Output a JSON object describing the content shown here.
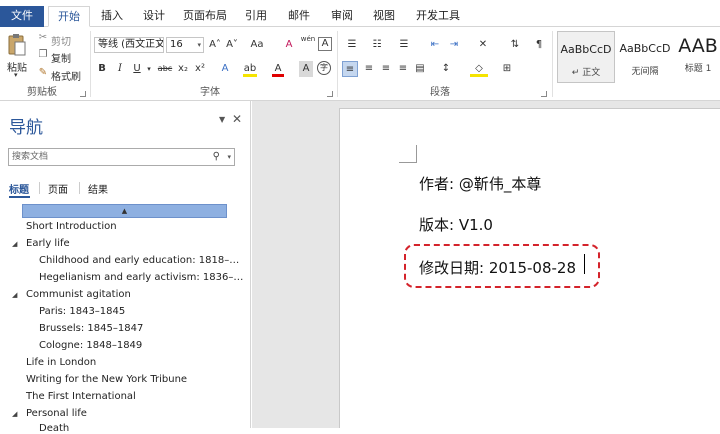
{
  "ribbon_tabs": [
    {
      "label": "文件"
    },
    {
      "label": "开始"
    },
    {
      "label": "插入"
    },
    {
      "label": "设计"
    },
    {
      "label": "页面布局"
    },
    {
      "label": "引用"
    },
    {
      "label": "邮件"
    },
    {
      "label": "审阅"
    },
    {
      "label": "视图"
    },
    {
      "label": "开发工具"
    }
  ],
  "clipboard": {
    "paste": "粘贴",
    "cut": "剪切",
    "copy": "复制",
    "format_painter": "格式刷",
    "group_label": "剪贴板"
  },
  "font": {
    "name": "等线 (西文正文",
    "size": "16",
    "group_label": "字体",
    "buttons": {
      "bold": "B",
      "italic": "I",
      "underline": "U",
      "strike": "abc",
      "subscript": "x₂",
      "superscript": "x²",
      "grow": "A˄",
      "shrink": "A˅",
      "case": "Aa",
      "clear": "A",
      "phonetic": "wén",
      "border_char": "A",
      "effects": "A",
      "highlight": "ab",
      "color": "A",
      "shade": "A",
      "enclose": "字"
    }
  },
  "paragraph": {
    "group_label": "段落"
  },
  "styles": [
    {
      "sample": "AaBbCcD",
      "name": "↵ 正文"
    },
    {
      "sample": "AaBbCcD",
      "name": "无间隔"
    },
    {
      "sample": "AAB",
      "name": "标题 1"
    }
  ],
  "nav": {
    "title": "导航",
    "search_placeholder": "搜索文档",
    "tabs": [
      "标题",
      "页面",
      "结果"
    ],
    "headings": [
      {
        "text": "Short Introduction"
      },
      {
        "text": "Early life"
      },
      {
        "text": "Childhood and early education: 1818–…"
      },
      {
        "text": "Hegelianism and early activism: 1836–…"
      },
      {
        "text": "Communist agitation"
      },
      {
        "text": "Paris: 1843–1845"
      },
      {
        "text": "Brussels: 1845–1847"
      },
      {
        "text": "Cologne: 1848–1849"
      },
      {
        "text": "Life in London"
      },
      {
        "text": "Writing for the New York Tribune"
      },
      {
        "text": "The First International"
      },
      {
        "text": "Personal life"
      },
      {
        "text": "Death"
      }
    ]
  },
  "document": {
    "lines": [
      {
        "text": "作者: @靳伟_本尊"
      },
      {
        "text": "版本: V1.0"
      },
      {
        "text": "修改日期: 2015-08-28"
      }
    ]
  }
}
